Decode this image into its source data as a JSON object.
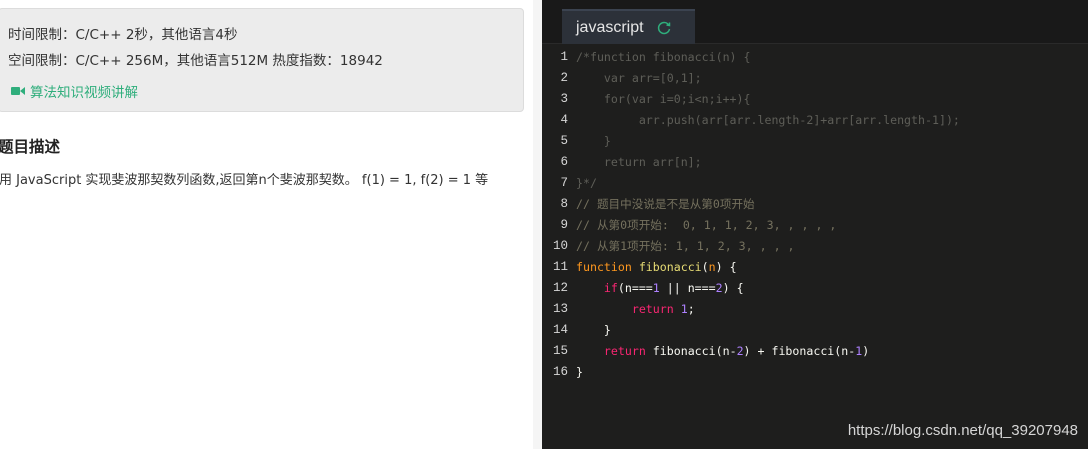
{
  "problem": {
    "time_limit": "时间限制：C/C++ 2秒，其他语言4秒",
    "space_limit": "空间限制：C/C++ 256M，其他语言512M    热度指数：18942",
    "video_link": "算法知识视频讲解",
    "section_title": "题目描述",
    "description": "用 JavaScript 实现斐波那契数列函数,返回第n个斐波那契数。 f(1) = 1, f(2) = 1 等"
  },
  "editor": {
    "tab_label": "javascript",
    "line_numbers": [
      "1",
      "2",
      "3",
      "4",
      "5",
      "6",
      "7",
      "8",
      "9",
      "10",
      "11",
      "12",
      "13",
      "14",
      "15",
      "16"
    ],
    "lines": [
      [
        {
          "t": "/*function fibonacci(n) {",
          "c": "cmt"
        }
      ],
      [
        {
          "t": "    var arr=[0,1];",
          "c": "cmt"
        }
      ],
      [
        {
          "t": "    for(var i=0;i<n;i++){",
          "c": "cmt"
        }
      ],
      [
        {
          "t": "         arr.push(arr[arr.length-2]+arr[arr.length-1]);",
          "c": "cmt"
        }
      ],
      [
        {
          "t": "    }",
          "c": "cmt"
        }
      ],
      [
        {
          "t": "    return arr[n];",
          "c": "cmt"
        }
      ],
      [
        {
          "t": "}*/",
          "c": "cmt"
        }
      ],
      [
        {
          "t": "// 题目中没说是不是从第0项开始",
          "c": "cmt2"
        }
      ],
      [
        {
          "t": "// 从第0项开始:  0, 1, 1, 2, 3, , , , ,",
          "c": "cmt2"
        }
      ],
      [
        {
          "t": "// 从第1项开始: 1, 1, 2, 3, , , ,",
          "c": "cmt2"
        }
      ],
      [
        {
          "t": "function ",
          "c": "fn"
        },
        {
          "t": "fibonacci",
          "c": "fnname"
        },
        {
          "t": "(",
          "c": "id"
        },
        {
          "t": "n",
          "c": "fn"
        },
        {
          "t": ") {",
          "c": "id"
        }
      ],
      [
        {
          "t": "    ",
          "c": "id"
        },
        {
          "t": "if",
          "c": "kw"
        },
        {
          "t": "(n===",
          "c": "id"
        },
        {
          "t": "1",
          "c": "num"
        },
        {
          "t": " || n===",
          "c": "id"
        },
        {
          "t": "2",
          "c": "num"
        },
        {
          "t": ") {",
          "c": "id"
        }
      ],
      [
        {
          "t": "        ",
          "c": "id"
        },
        {
          "t": "return ",
          "c": "kw"
        },
        {
          "t": "1",
          "c": "num"
        },
        {
          "t": ";",
          "c": "id"
        }
      ],
      [
        {
          "t": "    }",
          "c": "id"
        }
      ],
      [
        {
          "t": "    ",
          "c": "id"
        },
        {
          "t": "return ",
          "c": "kw"
        },
        {
          "t": "fibonacci(n-",
          "c": "id"
        },
        {
          "t": "2",
          "c": "num"
        },
        {
          "t": ") + fibonacci(n-",
          "c": "id"
        },
        {
          "t": "1",
          "c": "num"
        },
        {
          "t": ")",
          "c": "id"
        }
      ],
      [
        {
          "t": "}",
          "c": "id"
        }
      ]
    ]
  },
  "watermark": "https://blog.csdn.net/qq_39207948",
  "colors": {
    "accent_green": "#2fae7c",
    "editor_bg": "#1e1e1d",
    "tab_bg": "#2c3139"
  },
  "icons": {
    "video": "video-camera-icon",
    "refresh": "refresh-icon"
  }
}
